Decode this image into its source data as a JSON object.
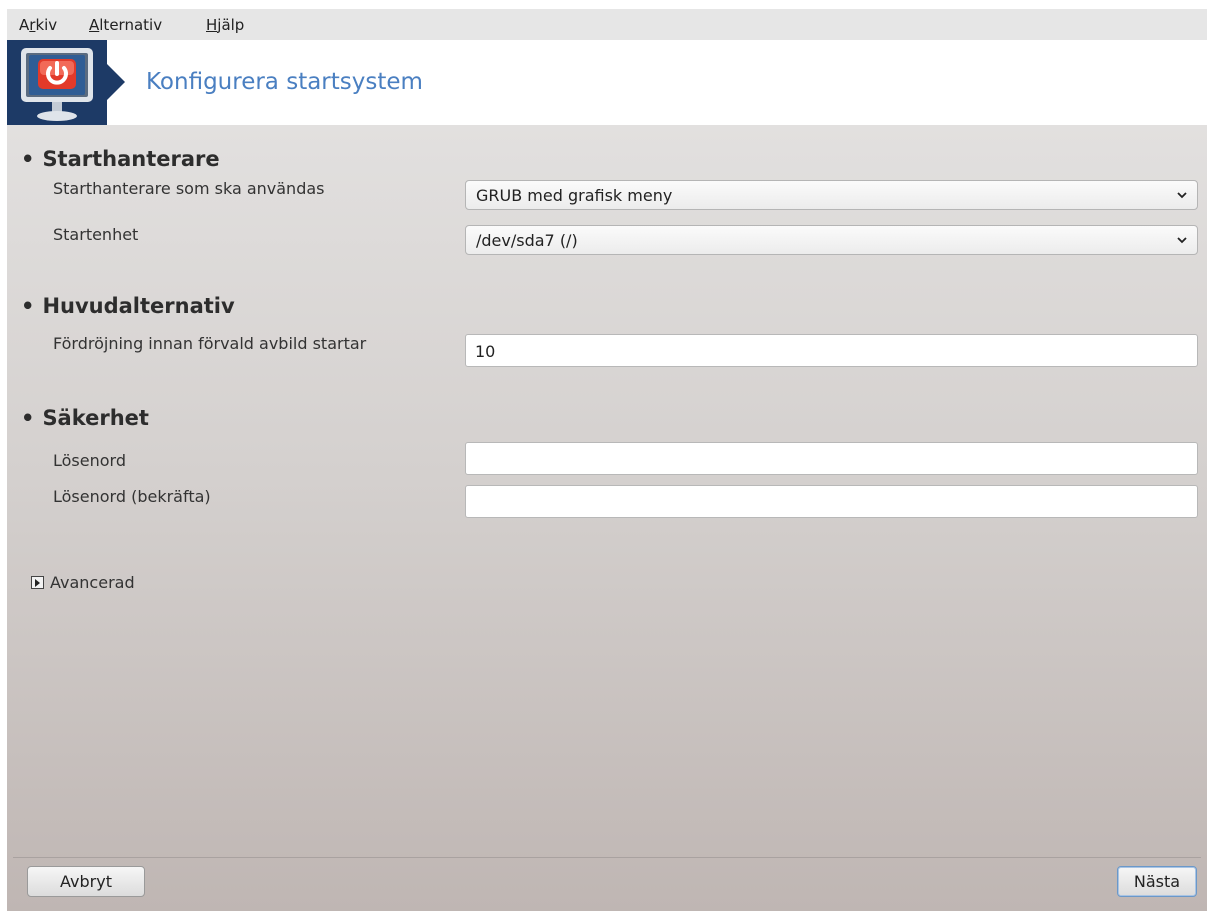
{
  "menubar": {
    "items": [
      {
        "before": "A",
        "underline": "r",
        "after": "kiv"
      },
      {
        "before": "",
        "underline": "A",
        "after": "lternativ"
      },
      {
        "before": "",
        "underline": "H",
        "after": "jälp"
      }
    ]
  },
  "banner": {
    "title": "Konfigurera startsystem",
    "icon": "power-monitor-icon",
    "colors": {
      "logo_bg": "#1d3a66",
      "title": "#4a7fc1"
    }
  },
  "sections": {
    "bootloader": {
      "title": "Starthanterare",
      "bootloader_label": "Starthanterare som ska användas",
      "bootloader_value": "GRUB med grafisk meny",
      "device_label": "Startenhet",
      "device_value": "/dev/sda7 (/)"
    },
    "main_options": {
      "title": "Huvudalternativ",
      "delay_label": "Fördröjning innan förvald avbild startar",
      "delay_value": "10"
    },
    "security": {
      "title": "Säkerhet",
      "password_label": "Lösenord",
      "password_value": "",
      "confirm_label": "Lösenord (bekräfta)",
      "confirm_value": ""
    }
  },
  "advanced": {
    "label": "Avancerad",
    "icon": "expand-arrow-icon"
  },
  "buttons": {
    "cancel": "Avbryt",
    "next": "Nästa"
  }
}
